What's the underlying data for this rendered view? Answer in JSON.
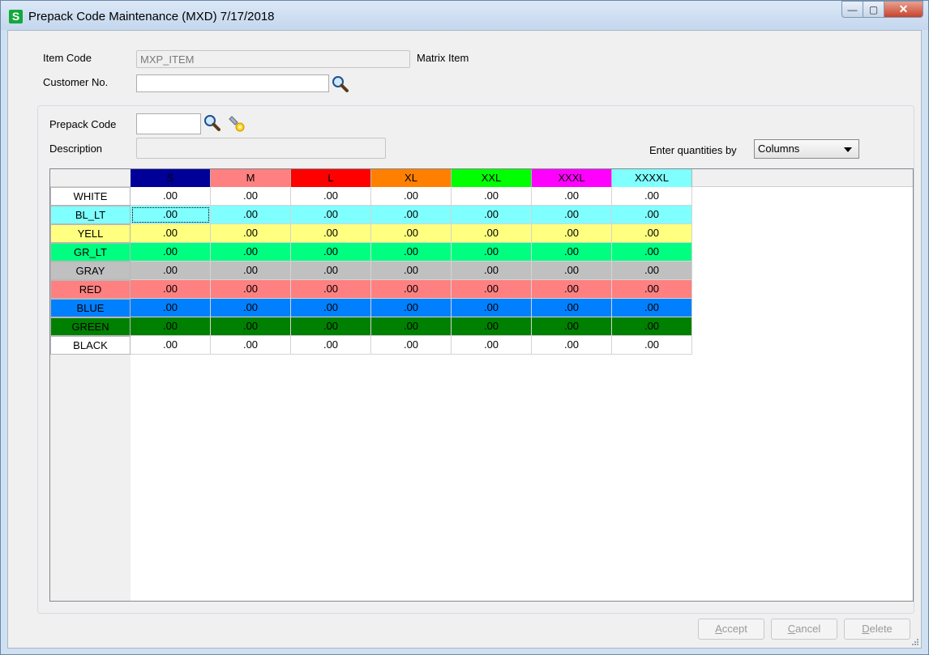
{
  "window": {
    "title": "Prepack Code Maintenance  (MXD) 7/17/2018",
    "app_icon_letter": "S",
    "minimize_glyph": "—",
    "maximize_glyph": "▢",
    "close_glyph": "✕"
  },
  "form": {
    "item_code_label": "Item Code",
    "item_code_value": "MXP_ITEM",
    "matrix_item_label": "Matrix Item",
    "customer_no_label": "Customer No.",
    "customer_no_value": "",
    "prepack_code_label": "Prepack Code",
    "prepack_code_value": "",
    "description_label": "Description",
    "description_value": "",
    "enter_qty_label": "Enter quantities by",
    "enter_qty_value": "Columns"
  },
  "grid": {
    "columns": [
      {
        "label": "S",
        "bg": "#000099",
        "fg": "#000000"
      },
      {
        "label": "M",
        "bg": "#ff8080",
        "fg": "#000000"
      },
      {
        "label": "L",
        "bg": "#ff0000",
        "fg": "#000000"
      },
      {
        "label": "XL",
        "bg": "#ff8000",
        "fg": "#000000"
      },
      {
        "label": "XXL",
        "bg": "#00ff00",
        "fg": "#000000"
      },
      {
        "label": "XXXL",
        "bg": "#ff00ff",
        "fg": "#000000"
      },
      {
        "label": "XXXXL",
        "bg": "#80ffff",
        "fg": "#000000"
      }
    ],
    "rows": [
      {
        "label": "WHITE",
        "bg": "#ffffff",
        "values": [
          ".00",
          ".00",
          ".00",
          ".00",
          ".00",
          ".00",
          ".00"
        ]
      },
      {
        "label": "BL_LT",
        "bg": "#80ffff",
        "values": [
          ".00",
          ".00",
          ".00",
          ".00",
          ".00",
          ".00",
          ".00"
        ]
      },
      {
        "label": "YELL",
        "bg": "#ffff80",
        "values": [
          ".00",
          ".00",
          ".00",
          ".00",
          ".00",
          ".00",
          ".00"
        ]
      },
      {
        "label": "GR_LT",
        "bg": "#00ff80",
        "values": [
          ".00",
          ".00",
          ".00",
          ".00",
          ".00",
          ".00",
          ".00"
        ]
      },
      {
        "label": "GRAY",
        "bg": "#c0c0c0",
        "values": [
          ".00",
          ".00",
          ".00",
          ".00",
          ".00",
          ".00",
          ".00"
        ]
      },
      {
        "label": "RED",
        "bg": "#ff8080",
        "values": [
          ".00",
          ".00",
          ".00",
          ".00",
          ".00",
          ".00",
          ".00"
        ]
      },
      {
        "label": "BLUE",
        "bg": "#0080ff",
        "values": [
          ".00",
          ".00",
          ".00",
          ".00",
          ".00",
          ".00",
          ".00"
        ]
      },
      {
        "label": "GREEN",
        "bg": "#008000",
        "values": [
          ".00",
          ".00",
          ".00",
          ".00",
          ".00",
          ".00",
          ".00"
        ]
      },
      {
        "label": "BLACK",
        "bg": "#ffffff",
        "values": [
          ".00",
          ".00",
          ".00",
          ".00",
          ".00",
          ".00",
          ".00"
        ]
      }
    ]
  },
  "buttons": {
    "accept_first": "A",
    "accept_rest": "ccept",
    "cancel_first": "C",
    "cancel_rest": "ancel",
    "delete_first": "D",
    "delete_rest": "elete"
  },
  "icons": {
    "customer_lookup": "magnifier-icon",
    "prepack_lookup": "magnifier-icon",
    "prepack_next": "flashlight-icon",
    "dropdown": "chevron-down-icon"
  }
}
